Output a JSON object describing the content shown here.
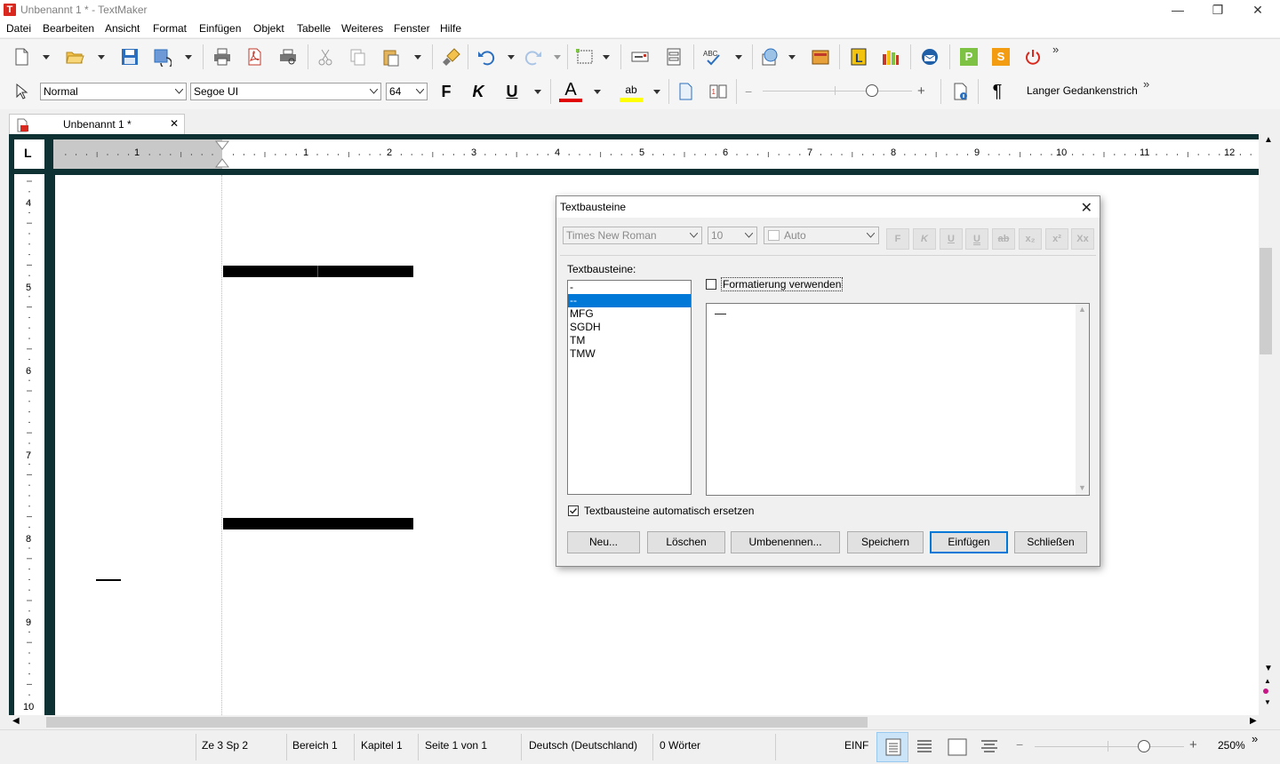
{
  "window": {
    "title": "Unbenannt 1 * - TextMaker",
    "app_icon_letter": "T",
    "minimize": "—",
    "restore": "❐",
    "close": "✕"
  },
  "menu": [
    "Datei",
    "Bearbeiten",
    "Ansicht",
    "Format",
    "Einfügen",
    "Objekt",
    "Tabelle",
    "Weiteres",
    "Fenster",
    "Hilfe"
  ],
  "toolbar2": {
    "style_value": "Normal",
    "font_value": "Segoe UI",
    "size_value": "64",
    "bold": "F",
    "italic": "K",
    "underline": "U",
    "font_color_letter": "A",
    "highlight_letters": "ab",
    "font_color": "#e00000",
    "highlight_color": "#ffff00",
    "pilcrow": "¶",
    "insert_label": "Langer Gedankenstrich",
    "overflow": "»"
  },
  "toolbar1": {
    "overflow": "»",
    "p_label": "P",
    "s_label": "S"
  },
  "tab": {
    "label": "Unbenannt 1 *",
    "close": "✕"
  },
  "ruler": {
    "corner": "L",
    "h_numbers": [
      "1",
      "1",
      "2",
      "3",
      "4",
      "5",
      "6",
      "7",
      "8",
      "9",
      "10",
      "11",
      "12"
    ],
    "v_numbers": [
      "4",
      "5",
      "6",
      "7",
      "8",
      "9",
      "10"
    ]
  },
  "dialog": {
    "title": "Textbausteine",
    "close": "✕",
    "font": "Times New Roman",
    "size": "10",
    "color": "Auto",
    "format_buttons": [
      "F",
      "K",
      "U",
      "U",
      "ab",
      "x₂",
      "x²",
      "Xx"
    ],
    "list_label": "Textbausteine:",
    "items": [
      "-",
      "--",
      "MFG",
      "SGDH",
      "TM",
      "TMW"
    ],
    "selected_index": 1,
    "use_formatting_label": "Formatierung verwenden",
    "preview_text": "—",
    "auto_replace_label": "Textbausteine automatisch ersetzen",
    "buttons": {
      "new": "Neu...",
      "delete": "Löschen",
      "rename": "Umbenennen...",
      "save": "Speichern",
      "insert": "Einfügen",
      "close": "Schließen"
    }
  },
  "status": {
    "position": "Ze 3 Sp 2",
    "area": "Bereich 1",
    "chapter": "Kapitel 1",
    "page": "Seite 1 von 1",
    "language": "Deutsch (Deutschland)",
    "words": "0 Wörter",
    "mode": "EINF",
    "zoom": "250%",
    "overflow": "»"
  }
}
